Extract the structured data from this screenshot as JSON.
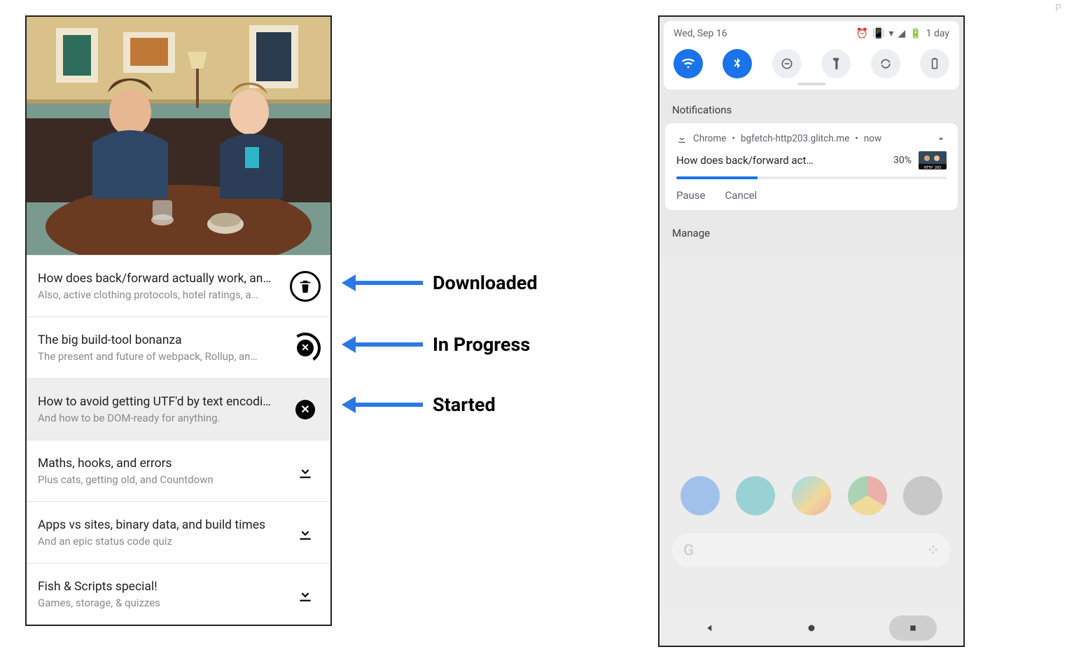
{
  "podcast": {
    "items": [
      {
        "title": "How does back/forward actually work, an…",
        "subtitle": "Also, active clothing protocols, hotel ratings, a…",
        "state": "downloaded"
      },
      {
        "title": "The big build-tool bonanza",
        "subtitle": "The present and future of webpack, Rollup, an…",
        "state": "in_progress"
      },
      {
        "title": "How to avoid getting UTF'd by text encodi…",
        "subtitle": "And how to be DOM-ready for anything.",
        "state": "started"
      },
      {
        "title": "Maths, hooks, and errors",
        "subtitle": "Plus cats, getting old, and Countdown",
        "state": "idle"
      },
      {
        "title": "Apps vs sites, binary data, and build times",
        "subtitle": "And an epic status code quiz",
        "state": "idle"
      },
      {
        "title": "Fish & Scripts special!",
        "subtitle": "Games, storage, & quizzes",
        "state": "idle"
      }
    ]
  },
  "annotations": {
    "downloaded": "Downloaded",
    "in_progress": "In Progress",
    "started": "Started"
  },
  "android": {
    "date": "Wed, Sep 16",
    "battery_text": "1 day",
    "notifications_header": "Notifications",
    "manage_label": "Manage",
    "notification": {
      "app": "Chrome",
      "source": "bgfetch-http203.glitch.me",
      "time": "now",
      "title_truncated": "How does back/forward act…",
      "percent_label": "30%",
      "percent_value": 30,
      "action_pause": "Pause",
      "action_cancel": "Cancel"
    },
    "search_letter": "G"
  }
}
